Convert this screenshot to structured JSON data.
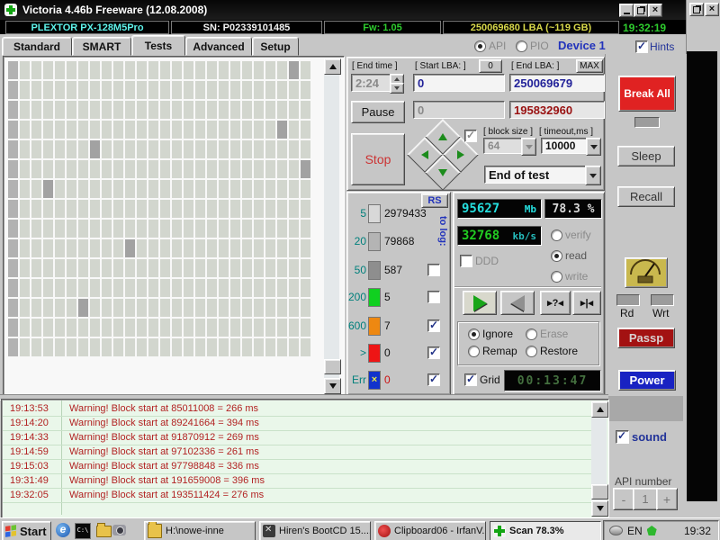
{
  "window": {
    "title": "Victoria 4.46b Freeware (12.08.2008)"
  },
  "info_bar": {
    "model": "PLEXTOR PX-128M5Pro",
    "serial": "SN: P02339101485",
    "firmware": "Fw: 1.05",
    "capacity": "250069680 LBA (~119 GB)",
    "clock": "19:32:19"
  },
  "tab_bar": {
    "tabs": [
      "Standard",
      "SMART",
      "Tests",
      "Advanced",
      "Setup"
    ],
    "active_tab": "Tests",
    "api_label": "API",
    "pio_label": "PIO",
    "device_label": "Device 1",
    "hints_label": "Hints"
  },
  "controls": {
    "end_time_label": "[ End time ]",
    "end_time_value": "2:24",
    "start_lba_label": "[ Start LBA: ]",
    "zero_button": "0",
    "start_lba_value": "0",
    "end_lba_label": "[ End LBA: ]",
    "max_button": "MAX",
    "end_lba_value": "250069679",
    "current_block": "0",
    "current_lba": "195832960",
    "pause_button": "Pause",
    "stop_button": "Stop",
    "block_size_label": "[ block size ]",
    "block_size_value": "64",
    "timeout_label": "[ timeout,ms ]",
    "timeout_value": "10000",
    "end_action": "End of test"
  },
  "legend": {
    "rs_button": "RS",
    "to_log_label": "to log:",
    "rows": [
      {
        "label": "5",
        "count": "2979433",
        "color": "#d8d8d8",
        "checkbox": "none",
        "count_color": "#111111",
        "err_mark": ""
      },
      {
        "label": "20",
        "count": "79868",
        "color": "#b4b4b4",
        "checkbox": "none",
        "count_color": "#111111",
        "err_mark": ""
      },
      {
        "label": "50",
        "count": "587",
        "color": "#8e8e8e",
        "checkbox": "unchecked",
        "count_color": "#111111",
        "err_mark": ""
      },
      {
        "label": "200",
        "count": "5",
        "color": "#10d020",
        "checkbox": "unchecked",
        "count_color": "#111111",
        "err_mark": ""
      },
      {
        "label": "600",
        "count": "7",
        "color": "#ee8811",
        "checkbox": "checked",
        "count_color": "#111111",
        "err_mark": ""
      },
      {
        "label": ">",
        "count": "0",
        "color": "#ee1515",
        "checkbox": "checked",
        "count_color": "#111111",
        "err_mark": ""
      },
      {
        "label": "Err",
        "count": "0",
        "color": "#1133cc",
        "checkbox": "checked",
        "count_color": "#cc1111",
        "err_mark": "×"
      }
    ]
  },
  "stats": {
    "mb_value": "95627",
    "mb_unit": "Mb",
    "percent": "78.3 %",
    "speed_value": "32768",
    "speed_unit": "kb/s",
    "ddd_label": "DDD",
    "verify_label": "verify",
    "read_label": "read",
    "write_label": "write",
    "seek_button": "▸?◂",
    "edge_button": "▸|◂",
    "ignore_label": "Ignore",
    "erase_label": "Erase",
    "remap_label": "Remap",
    "restore_label": "Restore",
    "grid_label": "Grid",
    "timer": "00:13:47"
  },
  "right_panel": {
    "break_all": "Break All",
    "sleep": "Sleep",
    "recall": "Recall",
    "rd_label": "Rd",
    "wrt_label": "Wrt",
    "passp": "Passp",
    "power": "Power",
    "sound_label": "sound",
    "api_number_label": "API number",
    "api_minus": "-",
    "api_value": "1",
    "api_plus": "+"
  },
  "block_map": {
    "cols": 26,
    "rows": 15,
    "cell_color": "#d2d6ce",
    "first_col_color": "#b2b2b2",
    "slow_color": "#a2a2a2",
    "slow_cells": [
      [
        24,
        0
      ],
      [
        23,
        3
      ],
      [
        7,
        4
      ],
      [
        25,
        5
      ],
      [
        3,
        6
      ],
      [
        10,
        9
      ],
      [
        6,
        12
      ]
    ]
  },
  "log": {
    "rows": [
      {
        "time": "19:13:53",
        "message": "Warning! Block start at 85011008 = 266 ms"
      },
      {
        "time": "19:14:20",
        "message": "Warning! Block start at 89241664 = 394 ms"
      },
      {
        "time": "19:14:33",
        "message": "Warning! Block start at 91870912 = 269 ms"
      },
      {
        "time": "19:14:59",
        "message": "Warning! Block start at 97102336 = 261 ms"
      },
      {
        "time": "19:15:03",
        "message": "Warning! Block start at 97798848 = 336 ms"
      },
      {
        "time": "19:31:49",
        "message": "Warning! Block start at 191659008 = 396 ms"
      },
      {
        "time": "19:32:05",
        "message": "Warning! Block start at 193511424 = 276 ms"
      }
    ]
  },
  "taskbar": {
    "start_label": "Start",
    "buttons": [
      {
        "label": "H:\\nowe-inne",
        "icon": "folder",
        "active": false
      },
      {
        "label": "Hiren's BootCD 15....",
        "icon": "tools",
        "active": false
      },
      {
        "label": "Clipboard06 - IrfanV...",
        "icon": "irfan",
        "active": false
      },
      {
        "label": "Scan 78.3%",
        "icon": "victoria",
        "active": true
      }
    ],
    "tray_lang": "EN",
    "tray_clock": "19:32"
  },
  "colors": {
    "model_cyan": "#5ef2ea",
    "fw_green": "#2ecc2e",
    "lba_yellow": "#d8d84a",
    "clock_green": "#2ecc2e",
    "lcd_cyan": "#25dede",
    "lcd_green": "#22cc22",
    "warning_red": "#b22222",
    "accent_blue": "#2233bb"
  }
}
